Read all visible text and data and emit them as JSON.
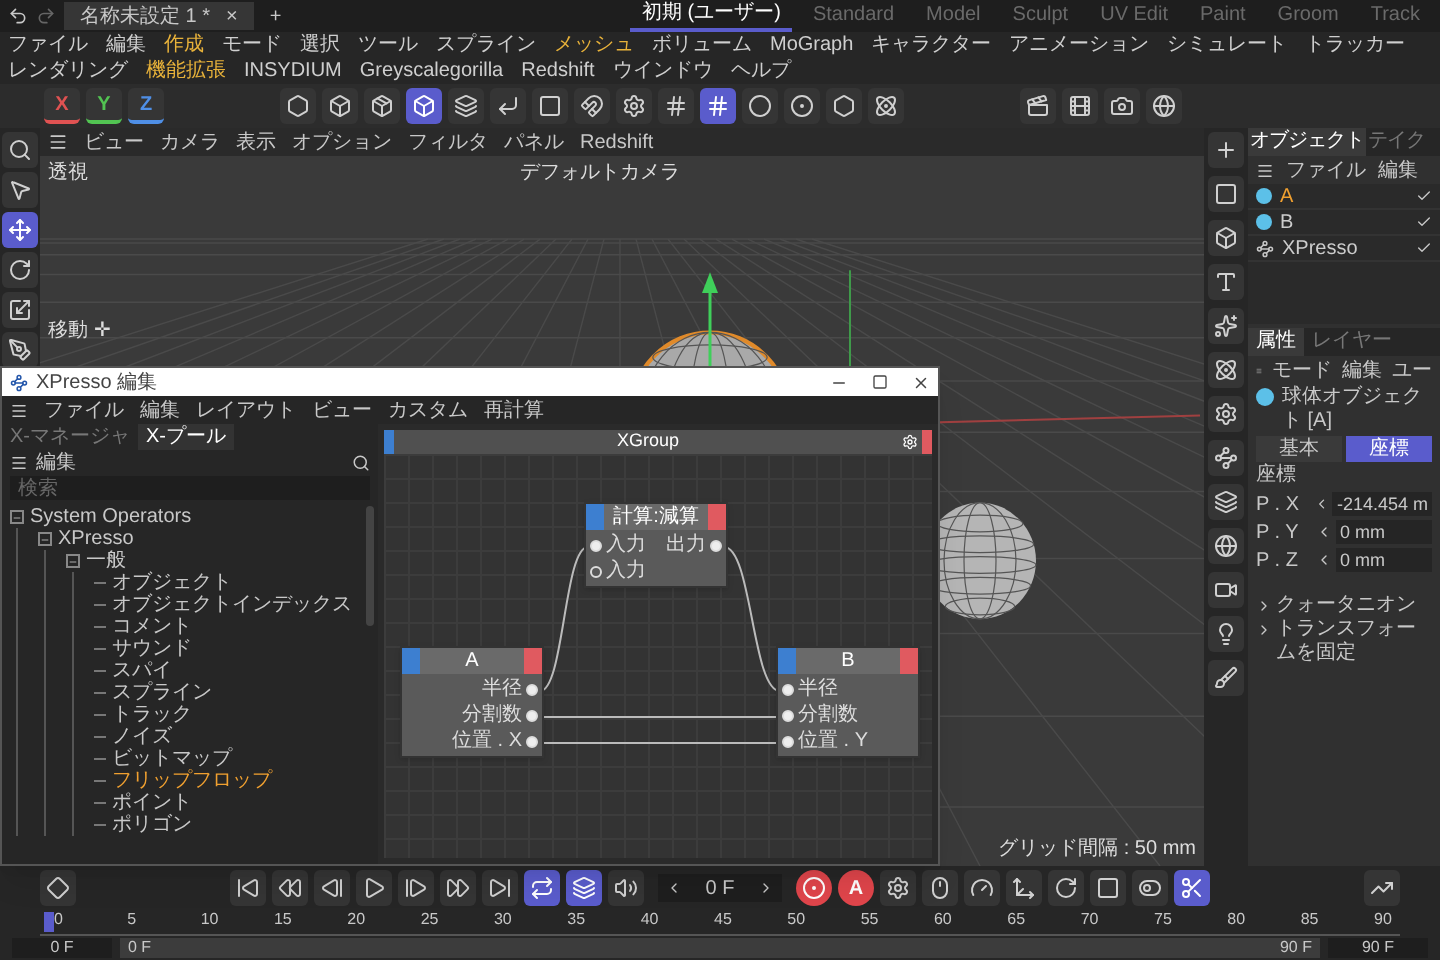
{
  "title_bar": {
    "document_tab": "名称未設定 1 *",
    "tab_close": "×",
    "new_tab": "+",
    "layouts": [
      {
        "label": "初期 (ユーザー)",
        "selected": true
      },
      {
        "label": "Standard",
        "selected": false
      },
      {
        "label": "Model",
        "selected": false
      },
      {
        "label": "Sculpt",
        "selected": false
      },
      {
        "label": "UV Edit",
        "selected": false
      },
      {
        "label": "Paint",
        "selected": false
      },
      {
        "label": "Groom",
        "selected": false
      },
      {
        "label": "Track",
        "selected": false
      }
    ]
  },
  "menu_bar": [
    {
      "label": "ファイル",
      "highlighted": false
    },
    {
      "label": "編集",
      "highlighted": false
    },
    {
      "label": "作成",
      "highlighted": true
    },
    {
      "label": "モード",
      "highlighted": false
    },
    {
      "label": "選択",
      "highlighted": false
    },
    {
      "label": "ツール",
      "highlighted": false
    },
    {
      "label": "スプライン",
      "highlighted": false
    },
    {
      "label": "メッシュ",
      "highlighted": true
    },
    {
      "label": "ボリューム",
      "highlighted": false
    },
    {
      "label": "MoGraph",
      "highlighted": false
    },
    {
      "label": "キャラクター",
      "highlighted": false
    },
    {
      "label": "アニメーション",
      "highlighted": false
    },
    {
      "label": "シミュレート",
      "highlighted": false
    },
    {
      "label": "トラッカー",
      "highlighted": false
    },
    {
      "label": "レンダリング",
      "highlighted": false
    },
    {
      "label": "機能拡張",
      "highlighted": true
    },
    {
      "label": "INSYDIUM",
      "highlighted": false
    },
    {
      "label": "Greyscalegorilla",
      "highlighted": false
    },
    {
      "label": "Redshift",
      "highlighted": false
    },
    {
      "label": "ウインドウ",
      "highlighted": false
    },
    {
      "label": "ヘルプ",
      "highlighted": false
    }
  ],
  "toolbar": {
    "axes": [
      {
        "label": "X",
        "color": "#e05252"
      },
      {
        "label": "Y",
        "color": "#52c452"
      },
      {
        "label": "Z",
        "color": "#4f8fe6"
      }
    ],
    "tools": [
      {
        "kind": "hexagon",
        "selected": false
      },
      {
        "kind": "cube",
        "selected": false
      },
      {
        "kind": "box",
        "selected": false
      },
      {
        "kind": "polygon-mode",
        "selected": true
      },
      {
        "kind": "layers",
        "selected": false
      },
      {
        "kind": "corner",
        "selected": false
      },
      {
        "kind": "square",
        "selected": false
      },
      {
        "kind": "magnet",
        "selected": false
      },
      {
        "kind": "gear",
        "selected": false
      },
      {
        "kind": "grid",
        "selected": false
      },
      {
        "kind": "grid",
        "selected": true
      },
      {
        "kind": "circle",
        "selected": false
      },
      {
        "kind": "target",
        "selected": false
      },
      {
        "kind": "hexagon",
        "selected": false
      },
      {
        "kind": "atom",
        "selected": false
      }
    ],
    "render_tools": [
      {
        "kind": "clapper",
        "selected": false
      },
      {
        "kind": "film",
        "selected": false
      },
      {
        "kind": "camera",
        "selected": false
      },
      {
        "kind": "globe",
        "selected": false
      }
    ]
  },
  "left_tools": [
    {
      "kind": "search",
      "selected": false
    },
    {
      "kind": "select",
      "selected": false
    },
    {
      "kind": "move",
      "selected": true
    },
    {
      "kind": "rotate",
      "selected": false
    },
    {
      "kind": "scale",
      "selected": false
    },
    {
      "kind": "pen",
      "selected": false
    }
  ],
  "viewport": {
    "menu": [
      "ビュー",
      "カメラ",
      "表示",
      "オプション",
      "フィルタ",
      "パネル",
      "Redshift"
    ],
    "view_name": "透視",
    "camera": "デフォルトカメラ",
    "tool_label": "移動 ✛",
    "grid_spacing": "グリッド間隔 : 50 mm"
  },
  "xpresso": {
    "title": "XPresso 編集",
    "menu": [
      "ファイル",
      "編集",
      "レイアウト",
      "ビュー",
      "カスタム",
      "再計算"
    ],
    "tabs": [
      {
        "label": "X-マネージャ",
        "selected": false
      },
      {
        "label": "X-プール",
        "selected": true
      }
    ],
    "pool_menu": "編集",
    "search_placeholder": "検索",
    "tree": [
      {
        "label": "System Operators",
        "expanded": true,
        "children": [
          {
            "label": "XPresso",
            "expanded": true,
            "children": [
              {
                "label": "一般",
                "expanded": true,
                "children": [
                  {
                    "label": "オブジェクト",
                    "selected": false
                  },
                  {
                    "label": "オブジェクトインデックス",
                    "selected": false
                  },
                  {
                    "label": "コメント",
                    "selected": false
                  },
                  {
                    "label": "サウンド",
                    "selected": false
                  },
                  {
                    "label": "スパイ",
                    "selected": false
                  },
                  {
                    "label": "スプライン",
                    "selected": false
                  },
                  {
                    "label": "トラック",
                    "selected": false
                  },
                  {
                    "label": "ノイズ",
                    "selected": false
                  },
                  {
                    "label": "ビットマップ",
                    "selected": false
                  },
                  {
                    "label": "フリップフロップ",
                    "selected": true
                  },
                  {
                    "label": "ポイント",
                    "selected": false
                  },
                  {
                    "label": "ポリゴン",
                    "selected": false
                  }
                ]
              }
            ]
          }
        ]
      }
    ],
    "group_title": "XGroup",
    "nodes": [
      {
        "title": "計算:減算",
        "inputs": [
          {
            "label": "入力",
            "connected": true
          },
          {
            "label": "入力",
            "connected": false
          }
        ],
        "outputs": [
          {
            "label": "出力",
            "connected": true
          }
        ]
      },
      {
        "title": "A",
        "outputs": [
          {
            "label": "半径",
            "connected": true
          },
          {
            "label": "分割数",
            "connected": true
          },
          {
            "label": "位置 . X",
            "connected": true
          }
        ]
      },
      {
        "title": "B",
        "inputs": [
          {
            "label": "半径",
            "connected": true
          },
          {
            "label": "分割数",
            "connected": true
          },
          {
            "label": "位置 . Y",
            "connected": true
          }
        ]
      }
    ]
  },
  "right_tools": [
    {
      "kind": "add-object",
      "selected": false
    },
    {
      "kind": "square",
      "selected": false
    },
    {
      "kind": "cube",
      "selected": false
    },
    {
      "kind": "text",
      "selected": false
    },
    {
      "kind": "sparkles",
      "selected": false
    },
    {
      "kind": "atom",
      "selected": false
    },
    {
      "kind": "gear",
      "selected": false
    },
    {
      "kind": "deform",
      "selected": false
    },
    {
      "kind": "layers",
      "selected": false
    },
    {
      "kind": "globe",
      "selected": false
    },
    {
      "kind": "video",
      "selected": false
    },
    {
      "kind": "light",
      "selected": false
    },
    {
      "kind": "brush",
      "selected": false
    }
  ],
  "object_manager": {
    "tabs": [
      {
        "label": "オブジェクト",
        "selected": true
      },
      {
        "label": "テイク",
        "selected": false
      }
    ],
    "menu": [
      "ファイル",
      "編集"
    ],
    "objects": [
      {
        "name": "A",
        "kind": "sphere",
        "selected": true
      },
      {
        "name": "B",
        "kind": "sphere",
        "selected": false
      },
      {
        "name": "XPresso",
        "kind": "xpresso",
        "selected": false
      }
    ]
  },
  "attributes": {
    "tabs": [
      {
        "label": "属性",
        "selected": true
      },
      {
        "label": "レイヤー",
        "selected": false
      }
    ],
    "menu": [
      "モード",
      "編集",
      "ユー"
    ],
    "object_name": "球体オブジェクト [A]",
    "sub_tabs": [
      {
        "label": "基本",
        "selected": false
      },
      {
        "label": "座標",
        "selected": true
      }
    ],
    "section": "座標",
    "fields": [
      {
        "label": "P . X",
        "value": "-214.454 m"
      },
      {
        "label": "P . Y",
        "value": "0 mm"
      },
      {
        "label": "P . Z",
        "value": "0 mm"
      }
    ],
    "groups": [
      "クォータニオン",
      "トランスフォームを固定"
    ]
  },
  "timeline": {
    "tools": [
      {
        "kind": "diamond",
        "selected": false
      },
      {
        "kind": "first",
        "selected": false
      },
      {
        "kind": "prevkey",
        "selected": false
      },
      {
        "kind": "prev",
        "selected": false
      },
      {
        "kind": "play",
        "selected": false
      },
      {
        "kind": "next",
        "selected": false
      },
      {
        "kind": "nextkey",
        "selected": false
      },
      {
        "kind": "last",
        "selected": false
      },
      {
        "kind": "loop",
        "selected": true
      },
      {
        "kind": "keymode",
        "selected": true
      },
      {
        "kind": "sound",
        "selected": false
      }
    ],
    "frame": "0 F",
    "record_tools": [
      {
        "kind": "record",
        "selected": false
      },
      {
        "kind": "autokey",
        "label": "A",
        "selected": false
      },
      {
        "kind": "gear",
        "selected": false
      },
      {
        "kind": "mouse",
        "selected": false
      },
      {
        "kind": "gauge",
        "selected": false
      },
      {
        "kind": "move3d",
        "selected": false
      },
      {
        "kind": "rotate",
        "selected": false
      },
      {
        "kind": "square",
        "selected": false
      },
      {
        "kind": "toggle",
        "selected": false
      },
      {
        "kind": "scissors",
        "selected": true
      }
    ],
    "graph_tool": {
      "kind": "graph",
      "selected": false
    },
    "ticks": [
      "0",
      "5",
      "10",
      "15",
      "20",
      "25",
      "30",
      "35",
      "40",
      "45",
      "50",
      "55",
      "60",
      "65",
      "70",
      "75",
      "80",
      "85",
      "90"
    ],
    "start": "0 F",
    "range_start": "0 F",
    "range_end": "90 F",
    "end": "90 F"
  }
}
